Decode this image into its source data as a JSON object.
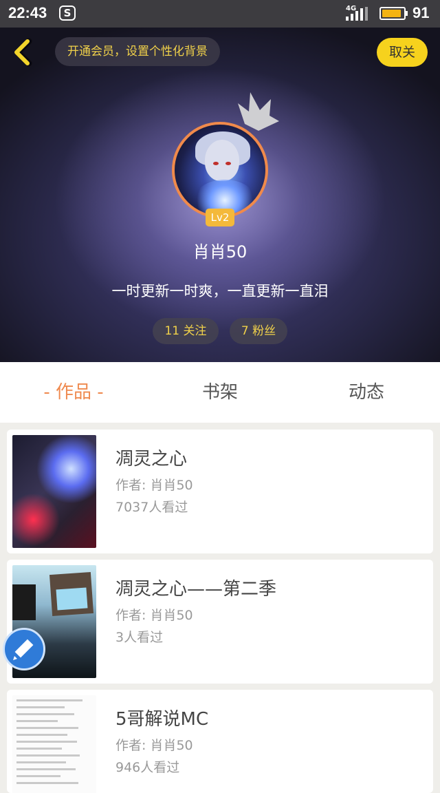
{
  "status_bar": {
    "time": "22:43",
    "app_icon": "S",
    "network": "4G",
    "battery": "91",
    "battery_fraction": 0.91,
    "accent": "#f3b313"
  },
  "header": {
    "vip_banner": "开通会员，设置个性化背景",
    "unfollow_label": "取关",
    "level_badge": "Lv2",
    "username": "肖肖50",
    "signature": "一时更新一时爽，一直更新一直泪",
    "following_label": "11 关注",
    "fans_label": "7 粉丝",
    "icons": {
      "back": "chevron-left-icon",
      "decoration": "crown-icon"
    }
  },
  "tabs": [
    {
      "label": "- 作品 -",
      "active": true
    },
    {
      "label": "书架",
      "active": false
    },
    {
      "label": "动态",
      "active": false
    }
  ],
  "works": [
    {
      "title": "凋灵之心",
      "author": "作者: 肖肖50",
      "views": "7037人看过"
    },
    {
      "title": "凋灵之心——第二季",
      "author": "作者: 肖肖50",
      "views": "3人看过"
    },
    {
      "title": "5哥解说MC",
      "author": "作者: 肖肖50",
      "views": "946人看过"
    }
  ],
  "colors": {
    "active_tab": "#ef8a4f",
    "highlight_text": "#f0d14a",
    "cancel_button": "#f6d21d",
    "avatar_ring": "#f08a4b"
  }
}
